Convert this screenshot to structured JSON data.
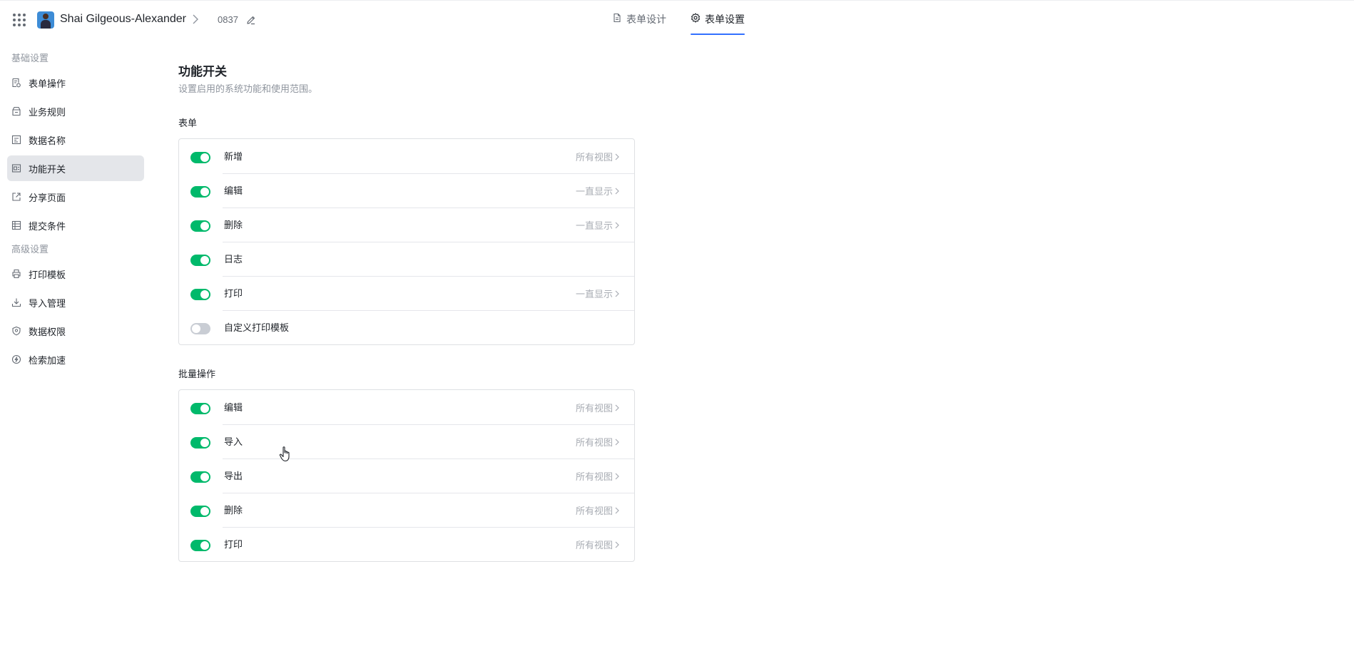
{
  "header": {
    "app_title": "Shai Gilgeous-Alexander",
    "form_id": "0837",
    "tabs": [
      {
        "label": "表单设计",
        "icon": "document-icon"
      },
      {
        "label": "表单设置",
        "icon": "gear-icon",
        "active": true
      }
    ]
  },
  "sidebar": {
    "groups": [
      {
        "title": "基础设置",
        "items": [
          {
            "label": "表单操作",
            "icon": "form-ops-icon"
          },
          {
            "label": "业务规则",
            "icon": "rules-icon"
          },
          {
            "label": "数据名称",
            "icon": "data-name-icon"
          },
          {
            "label": "功能开关",
            "icon": "switch-icon",
            "active": true
          },
          {
            "label": "分享页面",
            "icon": "share-icon"
          },
          {
            "label": "提交条件",
            "icon": "submit-condition-icon"
          }
        ]
      },
      {
        "title": "高级设置",
        "items": [
          {
            "label": "打印模板",
            "icon": "printer-icon"
          },
          {
            "label": "导入管理",
            "icon": "import-icon"
          },
          {
            "label": "数据权限",
            "icon": "shield-icon"
          },
          {
            "label": "检索加速",
            "icon": "lightning-icon"
          }
        ]
      }
    ]
  },
  "main": {
    "title": "功能开关",
    "description": "设置启用的系统功能和使用范围。",
    "sections": [
      {
        "title": "表单",
        "rows": [
          {
            "label": "新增",
            "on": true,
            "value": "所有视图"
          },
          {
            "label": "编辑",
            "on": true,
            "value": "一直显示"
          },
          {
            "label": "删除",
            "on": true,
            "value": "一直显示"
          },
          {
            "label": "日志",
            "on": true,
            "value": ""
          },
          {
            "label": "打印",
            "on": true,
            "value": "一直显示"
          },
          {
            "label": "自定义打印模板",
            "on": false,
            "value": ""
          }
        ]
      },
      {
        "title": "批量操作",
        "rows": [
          {
            "label": "编辑",
            "on": true,
            "value": "所有视图"
          },
          {
            "label": "导入",
            "on": true,
            "value": "所有视图"
          },
          {
            "label": "导出",
            "on": true,
            "value": "所有视图"
          },
          {
            "label": "删除",
            "on": true,
            "value": "所有视图"
          },
          {
            "label": "打印",
            "on": true,
            "value": "所有视图"
          }
        ]
      }
    ]
  },
  "colors": {
    "toggle_on": "#00b96b",
    "toggle_off": "#c9cdd4",
    "accent": "#3370ff",
    "active_nav_bg": "#e4e6ea"
  }
}
